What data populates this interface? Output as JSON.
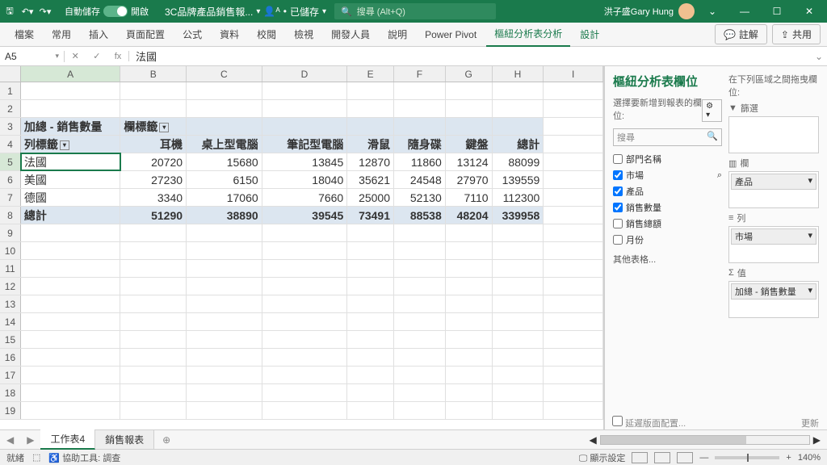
{
  "titlebar": {
    "autosave_label": "自動儲存",
    "autosave_state": "開啟",
    "doc_name": "3C品牌產品銷售報...",
    "saved_label": "已儲存",
    "search_placeholder": "搜尋 (Alt+Q)",
    "user_name": "洪子盛Gary Hung"
  },
  "ribbon": {
    "tabs": [
      "檔案",
      "常用",
      "插入",
      "頁面配置",
      "公式",
      "資料",
      "校閱",
      "檢視",
      "開發人員",
      "說明",
      "Power Pivot",
      "樞紐分析表分析",
      "設計"
    ],
    "comment_btn": "註解",
    "share_btn": "共用"
  },
  "fbar": {
    "cell_ref": "A5",
    "fx": "fx",
    "formula": "法國"
  },
  "columns": [
    "A",
    "B",
    "C",
    "D",
    "E",
    "F",
    "G",
    "H",
    "I"
  ],
  "pivot_table": {
    "r3": {
      "a": "加總 - 銷售數量",
      "b": "欄標籤"
    },
    "r4": {
      "a": "列標籤",
      "b": "耳機",
      "c": "桌上型電腦",
      "d": "筆記型電腦",
      "e": "滑鼠",
      "f": "隨身碟",
      "g": "鍵盤",
      "h": "總計"
    },
    "r5": {
      "a": "法國",
      "b": "20720",
      "c": "15680",
      "d": "13845",
      "e": "12870",
      "f": "11860",
      "g": "13124",
      "h": "88099"
    },
    "r6": {
      "a": "美國",
      "b": "27230",
      "c": "6150",
      "d": "18040",
      "e": "35621",
      "f": "24548",
      "g": "27970",
      "h": "139559"
    },
    "r7": {
      "a": "德國",
      "b": "3340",
      "c": "17060",
      "d": "7660",
      "e": "25000",
      "f": "52130",
      "g": "7110",
      "h": "112300"
    },
    "r8": {
      "a": "總計",
      "b": "51290",
      "c": "38890",
      "d": "39545",
      "e": "73491",
      "f": "88538",
      "g": "48204",
      "h": "339958"
    }
  },
  "pivot_pane": {
    "title": "樞紐分析表欄位",
    "help": "選擇要新增到報表的欄位:",
    "search_placeholder": "搜尋",
    "fields": [
      {
        "label": "部門名稱",
        "checked": false
      },
      {
        "label": "市場",
        "checked": true,
        "filtered": true
      },
      {
        "label": "產品",
        "checked": true
      },
      {
        "label": "銷售數量",
        "checked": true
      },
      {
        "label": "銷售總額",
        "checked": false
      },
      {
        "label": "月份",
        "checked": false
      }
    ],
    "other_tables": "其他表格...",
    "drag_help": "在下列區域之間拖曳欄位:",
    "zones": {
      "filter": "篩選",
      "columns": "欄",
      "columns_item": "產品",
      "rows": "列",
      "rows_item": "市場",
      "values": "值",
      "values_item": "加總 - 銷售數量"
    },
    "defer": "延遲版面配置...",
    "update": "更新"
  },
  "sheets": {
    "active": "工作表4",
    "other": "銷售報表"
  },
  "status": {
    "ready": "就緒",
    "access": "協助工具: 調查",
    "display": "顯示設定",
    "zoom": "140%"
  },
  "chart_data": {
    "type": "table",
    "title": "加總 - 銷售數量",
    "row_label": "列標籤 (市場)",
    "col_label": "欄標籤 (產品)",
    "columns": [
      "耳機",
      "桌上型電腦",
      "筆記型電腦",
      "滑鼠",
      "隨身碟",
      "鍵盤",
      "總計"
    ],
    "rows": [
      "法國",
      "美國",
      "德國",
      "總計"
    ],
    "data": [
      [
        20720,
        15680,
        13845,
        12870,
        11860,
        13124,
        88099
      ],
      [
        27230,
        6150,
        18040,
        35621,
        24548,
        27970,
        139559
      ],
      [
        3340,
        17060,
        7660,
        25000,
        52130,
        7110,
        112300
      ],
      [
        51290,
        38890,
        39545,
        73491,
        88538,
        48204,
        339958
      ]
    ]
  }
}
